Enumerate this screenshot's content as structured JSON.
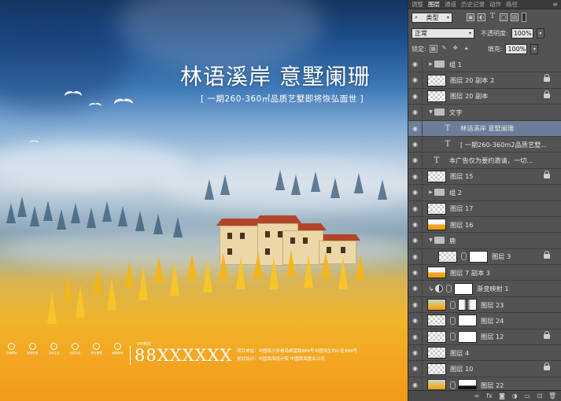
{
  "ad": {
    "title": "林语溪岸  意墅阑珊",
    "subtitle": "[ 一期260-360㎡品质艺墅即将恢弘面世 ]",
    "phone_label": "VIP热线",
    "phone": "88XXXXXX",
    "address_line1": "项目地址：中国南沙多看岛希望路888号中国恒生的小区888号",
    "address_line2": "规划设计：中国南海设计院  中国南海置业公司",
    "icons": [
      {
        "name": "icon-1",
        "caption": "交通便利"
      },
      {
        "name": "icon-2",
        "caption": "配套完善"
      },
      {
        "name": "icon-3",
        "caption": "自然生态"
      },
      {
        "name": "icon-4",
        "caption": "品质社区"
      },
      {
        "name": "icon-5",
        "caption": "物业管理"
      },
      {
        "name": "icon-6",
        "caption": "景观规划"
      }
    ]
  },
  "panel": {
    "tabs": [
      "调整",
      "图层",
      "通道",
      "历史记录",
      "动作",
      "路径"
    ],
    "active_tab": "图层",
    "filter_kind": "类型",
    "blend_mode": "正常",
    "opacity_label": "不透明度:",
    "opacity_value": "100%",
    "lock_label": "锁定:",
    "fill_label": "填充:",
    "fill_value": "100%",
    "layers": [
      {
        "name": "组 1",
        "type": "group",
        "indent": 0,
        "expanded": false,
        "locked": false
      },
      {
        "name": "图层 20 副本 2",
        "type": "layer",
        "thumb": "plain",
        "indent": 0,
        "locked": true
      },
      {
        "name": "图层 20 副本",
        "type": "layer",
        "thumb": "plain",
        "indent": 0,
        "locked": true
      },
      {
        "name": "文字",
        "type": "group",
        "indent": 0,
        "expanded": true,
        "locked": false
      },
      {
        "name": "林语溪岸  意墅阑珊",
        "type": "text",
        "indent": 1,
        "selected": true,
        "locked": false
      },
      {
        "name": "[ 一期260-360m2品质艺墅...",
        "type": "text",
        "indent": 1,
        "locked": false
      },
      {
        "name": "本广告仅为要约邀请，一切...",
        "type": "text",
        "indent": 0,
        "locked": false
      },
      {
        "name": "图层 15",
        "type": "layer",
        "thumb": "plain",
        "indent": 0,
        "locked": true
      },
      {
        "name": "组 2",
        "type": "group",
        "indent": 0,
        "expanded": false,
        "locked": false
      },
      {
        "name": "图层 17",
        "type": "layer",
        "thumb": "plain",
        "indent": 0,
        "locked": false
      },
      {
        "name": "图层 16",
        "type": "layer",
        "thumb": "orange",
        "indent": 0,
        "locked": false
      },
      {
        "name": "鹿",
        "type": "group",
        "indent": 0,
        "expanded": true,
        "locked": false
      },
      {
        "name": "图层 3",
        "type": "masked",
        "thumb": "plain",
        "mask": "mask",
        "indent": 1,
        "locked": true
      },
      {
        "name": "图层 7 副本 3",
        "type": "layer",
        "thumb": "orange",
        "indent": 0,
        "locked": false
      },
      {
        "name": "渐变映射 1",
        "type": "adjustment",
        "indent": 0,
        "locked": false
      },
      {
        "name": "图层 23",
        "type": "masked",
        "thumb": "gold",
        "mask": "dark",
        "indent": 0,
        "locked": false
      },
      {
        "name": "图层 24",
        "type": "masked",
        "thumb": "plain",
        "mask": "mask",
        "indent": 0,
        "locked": false
      },
      {
        "name": "图层 12",
        "type": "masked",
        "thumb": "plain",
        "mask": "mask",
        "indent": 0,
        "locked": true
      },
      {
        "name": "图层 4",
        "type": "layer",
        "thumb": "plain",
        "indent": 0,
        "locked": false
      },
      {
        "name": "图层 10",
        "type": "layer",
        "thumb": "plain",
        "indent": 0,
        "locked": true
      },
      {
        "name": "图层 22",
        "type": "masked",
        "thumb": "gold",
        "mask": "mask-black",
        "indent": 0,
        "locked": false
      }
    ],
    "footer_icons": [
      "link-icon",
      "fx-icon",
      "mask-icon",
      "adjustment-icon",
      "folder-icon",
      "new-layer-icon",
      "trash-icon"
    ]
  }
}
